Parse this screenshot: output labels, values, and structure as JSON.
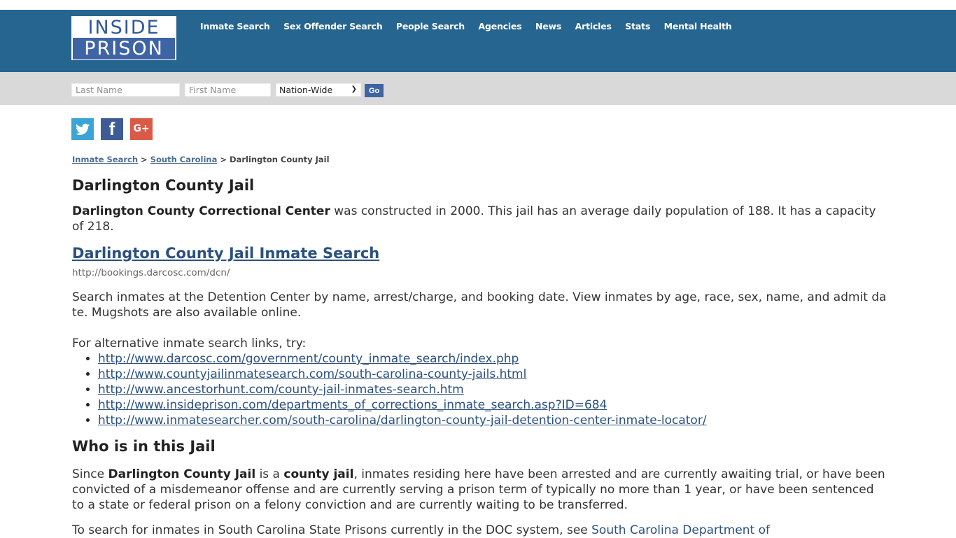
{
  "logo": {
    "line1": "INSIDE",
    "line2": "PRISON"
  },
  "nav": [
    {
      "label": "Inmate Search"
    },
    {
      "label": "Sex Offender Search"
    },
    {
      "label": "People Search"
    },
    {
      "label": "Agencies"
    },
    {
      "label": "News"
    },
    {
      "label": "Articles"
    },
    {
      "label": "Stats"
    },
    {
      "label": "Mental Health"
    }
  ],
  "search": {
    "last_name_placeholder": "Last Name",
    "first_name_placeholder": "First Name",
    "scope_selected": "Nation-Wide",
    "go_label": "Go"
  },
  "social": {
    "twitter": "t",
    "facebook": "f",
    "google": "G+"
  },
  "breadcrumb": {
    "items": [
      "Inmate Search",
      "South Carolina"
    ],
    "separator": ">",
    "current": "Darlington County Jail"
  },
  "page": {
    "title": "Darlington County Jail",
    "intro_bold": "Darlington County Correctional Center",
    "intro_rest": " was constructed in 2000. This jail has an average daily population of 188. It has a capacity of 218.",
    "inmate_search_link": "Darlington County Jail Inmate Search",
    "inmate_search_url": "http://bookings.darcosc.com/dcn/",
    "description": "Search inmates at the Detention Center by name, arrest/charge, and booking date. View inmates by age, race, sex, name, and admit date. Mugshots are also available online.",
    "alt_intro": "For alternative inmate search links, try:",
    "alt_links": [
      "http://www.darcosc.com/government/county_inmate_search/index.php",
      "http://www.countyjailinmatesearch.com/south-carolina-county-jails.html",
      "http://www.ancestorhunt.com/county-jail-inmates-search.htm",
      "http://www.insideprison.com/departments_of_corrections_inmate_search.asp?ID=684",
      "http://www.inmatesearcher.com/south-carolina/darlington-county-jail-detention-center-inmate-locator/"
    ],
    "who_heading": "Who is in this Jail",
    "who_p1": "Since ",
    "who_b1": "Darlington County Jail",
    "who_p2": " is a ",
    "who_b2": "county jail",
    "who_p3": ", inmates residing here have been arrested and are currently awaiting trial, or have been convicted of a misdemeanor offense and are currently serving a prison term of typically no more than 1 year, or have been sentenced to a state or federal prison on a felony conviction and are currently waiting to be transferred.",
    "dept_text": "To search for inmates in South Carolina State Prisons currently in the DOC system, see ",
    "dept_link": "South Carolina Department of"
  }
}
